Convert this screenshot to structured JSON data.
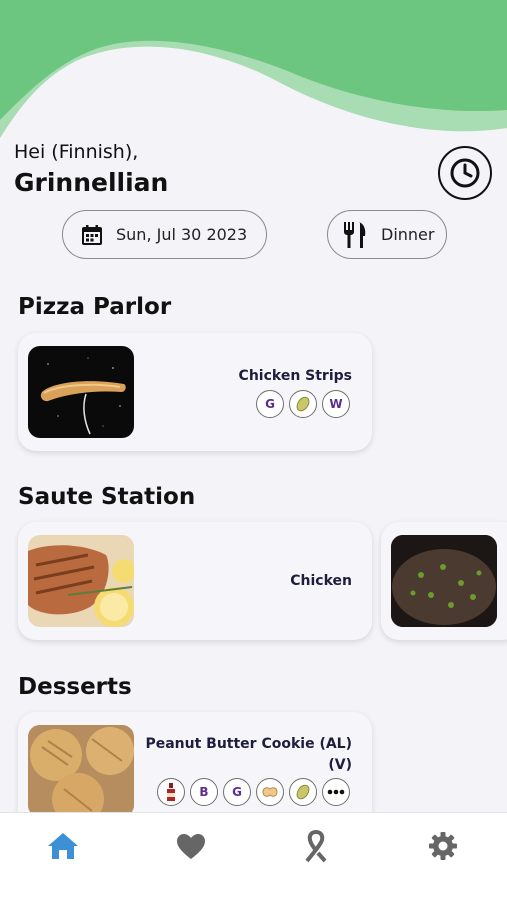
{
  "header": {
    "greeting": "Hei (Finnish),",
    "name": "Grinnellian",
    "history_icon": "clock-icon"
  },
  "filters": {
    "date_label": "Sun, Jul 30 2023",
    "date_icon": "calendar-icon",
    "meal_label": "Dinner",
    "meal_icon": "fork-knife-icon"
  },
  "stations": [
    {
      "title": "Pizza Parlor",
      "items": [
        {
          "name": "Chicken Strips",
          "badges": [
            "G",
            "bean",
            "W"
          ]
        }
      ]
    },
    {
      "title": "Saute Station",
      "items": [
        {
          "name": "Chicken",
          "badges": []
        },
        {
          "name": "",
          "badges": []
        }
      ]
    },
    {
      "title": "Desserts",
      "items": [
        {
          "name_line1": "Peanut Butter Cookie (AL)",
          "name_line2": "(V)",
          "badges": [
            "bottle",
            "B",
            "G",
            "peanut",
            "bean",
            "more"
          ]
        }
      ]
    }
  ],
  "tabs": [
    {
      "name": "home",
      "icon": "home-icon",
      "active": true
    },
    {
      "name": "favorites",
      "icon": "heart-icon",
      "active": false
    },
    {
      "name": "allergens",
      "icon": "ribbon-icon",
      "active": false
    },
    {
      "name": "settings",
      "icon": "gear-icon",
      "active": false
    }
  ],
  "colors": {
    "header_green": "#6cc67f",
    "header_green_light": "#a8dcb2",
    "active_tab": "#3d8fd6",
    "inactive_tab": "#666666",
    "badge_purple": "#5b2d8e"
  }
}
